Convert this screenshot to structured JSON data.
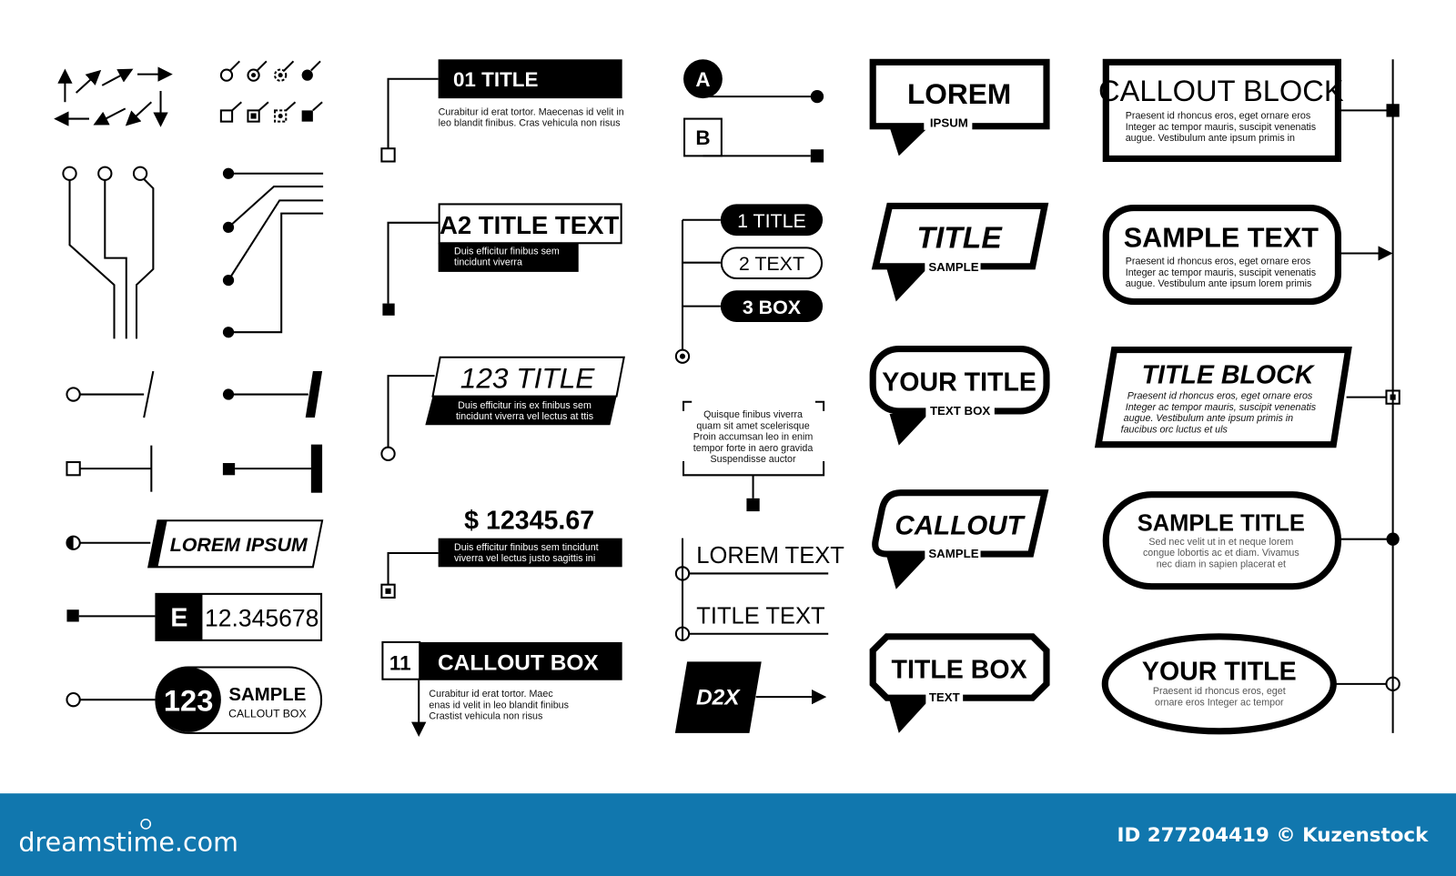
{
  "col1": {
    "lorem": "LOREM IPSUM",
    "e_label": "E",
    "e_value": "12.345678",
    "badge_num": "123",
    "badge_title": "SAMPLE",
    "badge_sub": "CALLOUT BOX"
  },
  "col2": {
    "t1": "01 TITLE",
    "t1_desc": [
      "Curabitur id erat tortor. Maecenas id velit in",
      "leo blandit finibus. Cras vehicula non risus"
    ],
    "t2": "A2 TITLE TEXT",
    "t2_desc": [
      "Duis efficitur finibus sem",
      "tincidunt viverra"
    ],
    "t3": "123 TITLE",
    "t3_desc": [
      "Duis efficitur iris ex finibus sem",
      "tincidunt viverra vel lectus at ttis"
    ],
    "t4": "$ 12345.67",
    "t4_desc": [
      "Duis efficitur finibus sem tincidunt",
      "viverra vel lectus justo sagittis ini"
    ],
    "t5_num": "11",
    "t5": "CALLOUT BOX",
    "t5_desc": [
      "Curabitur id erat tortor. Maec",
      "enas id velit in leo blandit finibus",
      "Crastist vehicula non risus"
    ]
  },
  "col3": {
    "a": "A",
    "b": "B",
    "list": [
      "1 TITLE",
      "2 TEXT",
      "3 BOX"
    ],
    "bracket_text": [
      "Quisque finibus viverra",
      "quam sit amet scelerisque",
      "Proin accumsan leo in enim",
      "tempor forte in aero gravida",
      "Suspendisse auctor"
    ],
    "lorem_text": "LOREM TEXT",
    "title_text": "TITLE TEXT",
    "d2x": "D2X"
  },
  "col4": {
    "b1": {
      "title": "LOREM",
      "sub": "IPSUM"
    },
    "b2": {
      "title": "TITLE",
      "sub": "SAMPLE"
    },
    "b3": {
      "title": "YOUR TITLE",
      "sub": "TEXT BOX"
    },
    "b4": {
      "title": "CALLOUT",
      "sub": "SAMPLE"
    },
    "b5": {
      "title": "TITLE BOX",
      "sub": "TEXT"
    }
  },
  "col5": {
    "c1": {
      "title": "CALLOUT BLOCK",
      "desc": [
        "Praesent id rhoncus eros, eget ornare eros",
        "Integer ac tempor mauris, suscipit venenatis",
        "augue. Vestibulum ante ipsum primis in"
      ]
    },
    "c2": {
      "title": "SAMPLE TEXT",
      "desc": [
        "Praesent id rhoncus eros, eget ornare eros",
        "Integer ac tempor mauris, suscipit venenatis",
        "augue. Vestibulum ante ipsum lorem primis"
      ]
    },
    "c3": {
      "title": "TITLE BLOCK",
      "desc": [
        "Praesent id rhoncus eros, eget ornare eros",
        "Integer ac tempor mauris, suscipit venenatis",
        "augue. Vestibulum ante ipsum primis in",
        "faucibus orc luctus et uls"
      ]
    },
    "c4": {
      "title": "SAMPLE TITLE",
      "desc": [
        "Sed nec velit ut in et neque lorem",
        "congue lobortis ac et diam. Vivamus",
        "nec diam in sapien placerat et"
      ]
    },
    "c5": {
      "title": "YOUR TITLE",
      "desc": [
        "Praesent id rhoncus eros, eget",
        "ornare eros Integer ac tempor"
      ]
    }
  },
  "footer": {
    "logo": "dreamstime.com",
    "credit": "ID 277204419 © Kuzenstock",
    "color": "#1177ae"
  }
}
